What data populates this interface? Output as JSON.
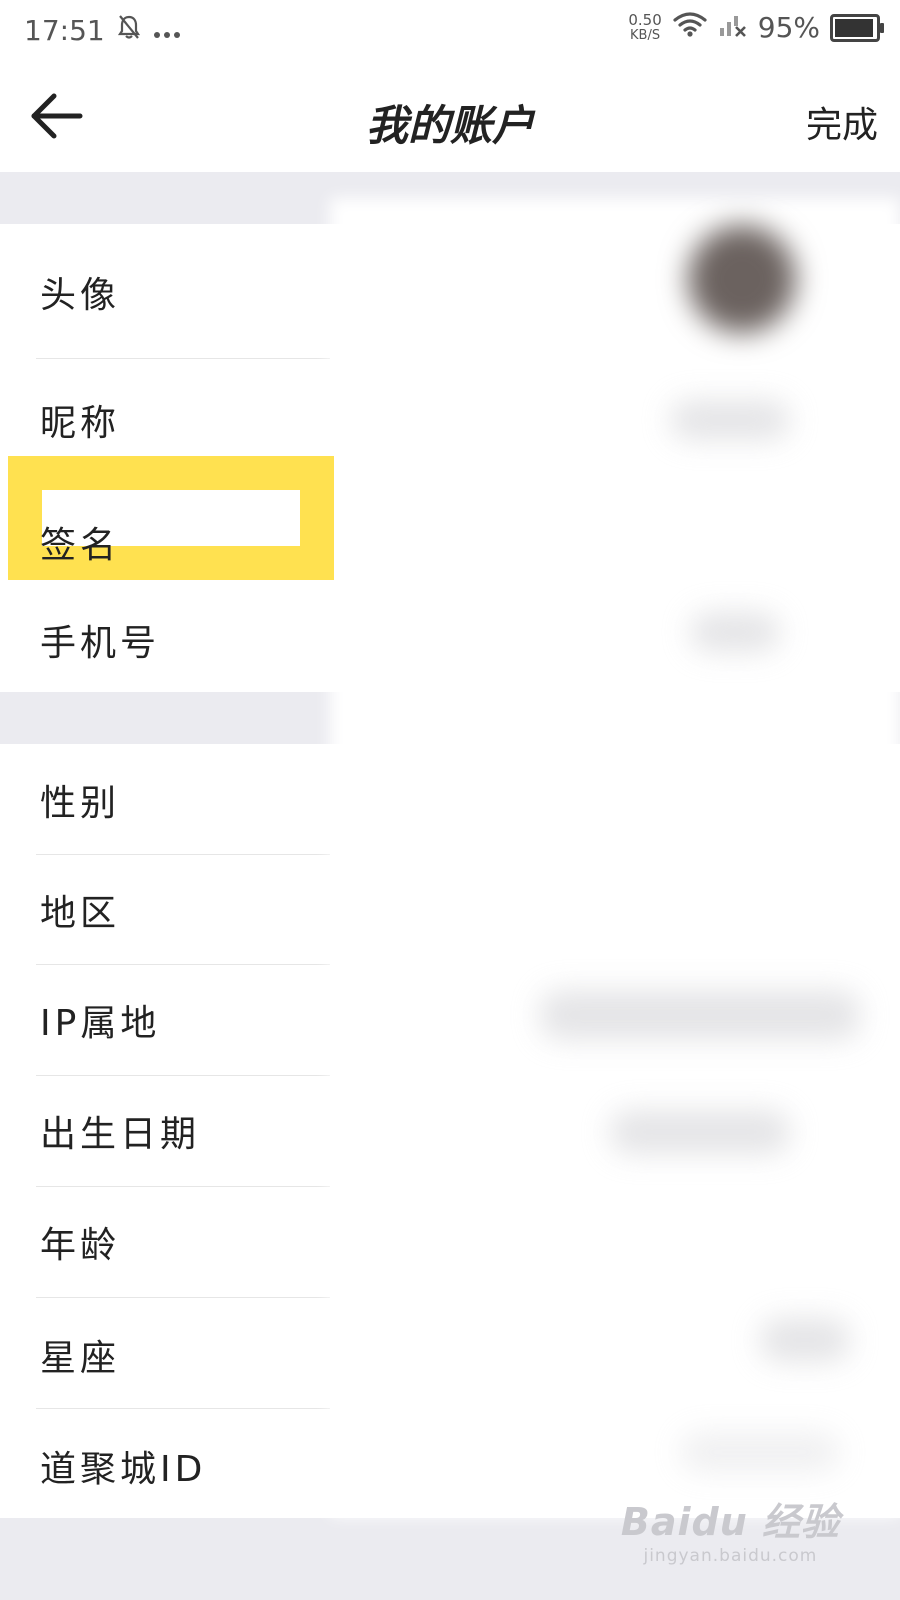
{
  "status_bar": {
    "time": "17:51",
    "icons": [
      "bell-off-icon",
      "more-dots-icon"
    ],
    "net_speed_value": "0.50",
    "net_speed_unit": "KB/S",
    "right_icons": [
      "wifi-icon",
      "signal-off-icon"
    ],
    "battery_text": "95%",
    "battery_level": 0.95
  },
  "header": {
    "back_icon": "arrow-left-icon",
    "title": "我的账户",
    "done_label": "完成"
  },
  "groups": [
    {
      "items": [
        {
          "label": "头像"
        },
        {
          "label": "昵称"
        },
        {
          "label": "签名",
          "highlighted": true
        },
        {
          "label": "手机号"
        }
      ]
    },
    {
      "items": [
        {
          "label": "性别"
        },
        {
          "label": "地区"
        },
        {
          "label": "IP属地"
        },
        {
          "label": "出生日期"
        },
        {
          "label": "年龄"
        },
        {
          "label": "星座"
        },
        {
          "label": "道聚城ID"
        }
      ]
    }
  ],
  "highlight_color": "#ffe150",
  "background_color": "#ebebf0",
  "watermark": {
    "main": "Baidu 经验",
    "sub": "jingyan.baidu.com"
  }
}
